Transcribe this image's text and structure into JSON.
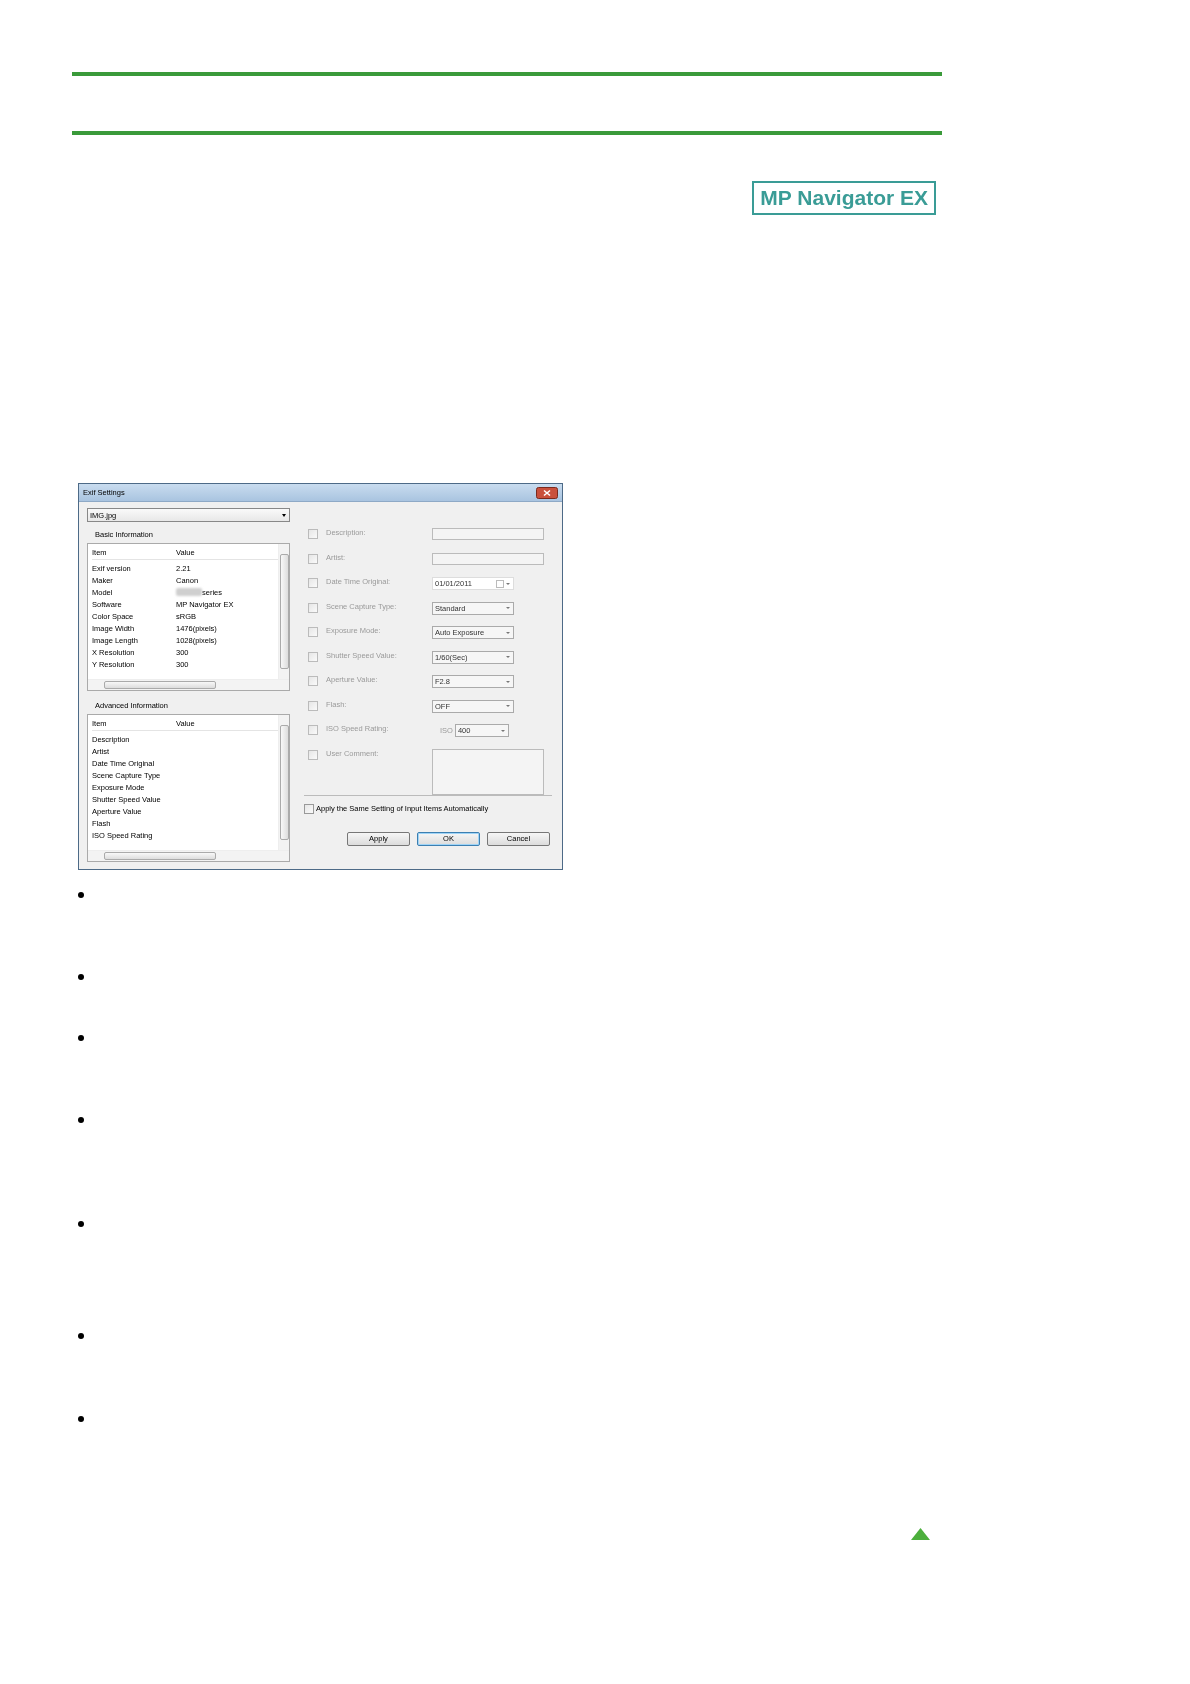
{
  "page": {
    "logo": "MP Navigator EX"
  },
  "dialog": {
    "title": "Exif Settings",
    "file_select": "IMG.jpg",
    "basic": {
      "title": "Basic Information",
      "columns": [
        "Item",
        "Value"
      ],
      "rows": [
        {
          "item": "Exif version",
          "value": "2.21"
        },
        {
          "item": "Maker",
          "value": "Canon"
        },
        {
          "item": "Model",
          "value": "series",
          "redacted": true
        },
        {
          "item": "Software",
          "value": "MP Navigator EX"
        },
        {
          "item": "Color Space",
          "value": "sRGB"
        },
        {
          "item": "Image Width",
          "value": "1476(pixels)"
        },
        {
          "item": "Image Length",
          "value": "1028(pixels)"
        },
        {
          "item": "X Resolution",
          "value": "300"
        },
        {
          "item": "Y Resolution",
          "value": "300"
        }
      ]
    },
    "advanced": {
      "title": "Advanced Information",
      "columns": [
        "Item",
        "Value"
      ],
      "rows": [
        {
          "item": "Description"
        },
        {
          "item": "Artist"
        },
        {
          "item": "Date Time Original"
        },
        {
          "item": "Scene Capture Type"
        },
        {
          "item": "Exposure Mode"
        },
        {
          "item": "Shutter Speed Value"
        },
        {
          "item": "Aperture Value"
        },
        {
          "item": "Flash"
        },
        {
          "item": "ISO Speed Rating"
        }
      ]
    },
    "fields": [
      {
        "kind": "text",
        "label": "Description:",
        "checked": false,
        "disabled": true
      },
      {
        "kind": "text",
        "label": "Artist:",
        "checked": false,
        "disabled": true
      },
      {
        "kind": "date",
        "label": "Date Time Original:",
        "value": "01/01/2011",
        "checked": false,
        "disabled": true
      },
      {
        "kind": "select",
        "label": "Scene Capture Type:",
        "value": "Standard",
        "checked": false,
        "disabled": true
      },
      {
        "kind": "select",
        "label": "Exposure Mode:",
        "value": "Auto Exposure",
        "checked": false,
        "disabled": true
      },
      {
        "kind": "select",
        "label": "Shutter Speed Value:",
        "value": "1/60(Sec)",
        "checked": false,
        "disabled": true
      },
      {
        "kind": "select",
        "label": "Aperture Value:",
        "value": "F2.8",
        "checked": false,
        "disabled": true
      },
      {
        "kind": "select",
        "label": "Flash:",
        "value": "OFF",
        "checked": false,
        "disabled": true
      },
      {
        "kind": "iso",
        "label": "ISO Speed Rating:",
        "prefix": "ISO",
        "value": "400",
        "checked": false,
        "disabled": true
      },
      {
        "kind": "textarea",
        "label": "User Comment:",
        "checked": false,
        "disabled": true
      }
    ],
    "auto_apply": {
      "label": "Apply the Same Setting of Input Items Automatically",
      "checked": false
    },
    "buttons": [
      {
        "label": "Apply",
        "default": false
      },
      {
        "label": "OK",
        "default": true
      },
      {
        "label": "Cancel",
        "default": false
      }
    ]
  }
}
